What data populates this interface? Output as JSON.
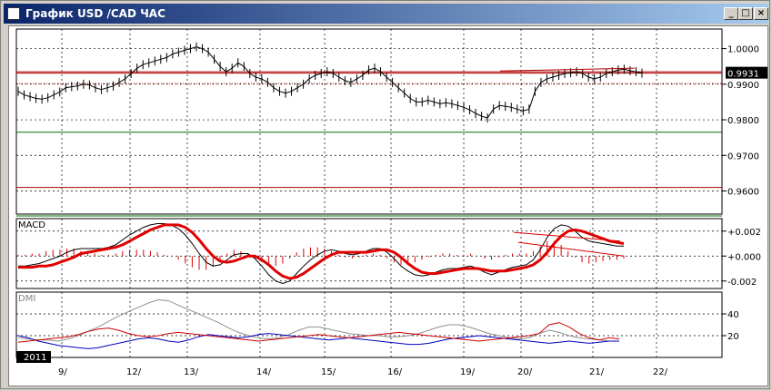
{
  "window": {
    "title": "График USD /CAD  ЧАС",
    "minimize_icon": "minimize-icon",
    "maximize_icon": "maximize-icon",
    "close_icon": "close-icon"
  },
  "colors": {
    "price": "#000000",
    "hline_red": "#b00000",
    "hline_green": "#007000",
    "macd_main": "#000000",
    "macd_signal": "#e00000",
    "macd_hist": "#e00000",
    "dmi_plus": "#0000c0",
    "dmi_minus": "#d00000",
    "adx": "#909090",
    "price_box_bg": "#000000"
  },
  "chart_data": [
    {
      "type": "line",
      "panel": "price",
      "current_price_label": "0.9931",
      "y_tick_labels": [
        "1.0000",
        "0.9900",
        "0.9800",
        "0.9700",
        "0.9600"
      ],
      "y_ticks": [
        1.0,
        0.99,
        0.98,
        0.97,
        0.96
      ],
      "ylim": [
        0.9535,
        1.0055
      ],
      "x_tick_labels": [
        "9/",
        "12/",
        "13/",
        "14/",
        "15/",
        "16/",
        "19/",
        "20/",
        "21/",
        "22/"
      ],
      "year_label": "2011",
      "horizontal_lines": [
        {
          "value": 0.9935,
          "color": "red"
        },
        {
          "value": 0.9931,
          "color": "red"
        },
        {
          "value": 0.9902,
          "color": "red",
          "dashed": true
        },
        {
          "value": 0.9765,
          "color": "green"
        },
        {
          "value": 0.961,
          "color": "red"
        },
        {
          "value": 0.953,
          "color": "green"
        }
      ],
      "close": [
        0.988,
        0.987,
        0.9865,
        0.986,
        0.9858,
        0.9862,
        0.987,
        0.9878,
        0.989,
        0.9893,
        0.9895,
        0.99,
        0.9898,
        0.989,
        0.9885,
        0.989,
        0.9895,
        0.9905,
        0.9915,
        0.993,
        0.9945,
        0.9955,
        0.996,
        0.9965,
        0.997,
        0.9975,
        0.9985,
        0.999,
        0.9995,
        1.0,
        1.0005,
        1.0,
        0.999,
        0.997,
        0.995,
        0.9935,
        0.9945,
        0.996,
        0.995,
        0.993,
        0.992,
        0.9915,
        0.9905,
        0.989,
        0.988,
        0.9875,
        0.988,
        0.989,
        0.99,
        0.9915,
        0.9925,
        0.993,
        0.9935,
        0.993,
        0.992,
        0.991,
        0.9905,
        0.9915,
        0.9925,
        0.994,
        0.9945,
        0.9935,
        0.992,
        0.9905,
        0.989,
        0.9875,
        0.986,
        0.985,
        0.985,
        0.9855,
        0.985,
        0.9845,
        0.9848,
        0.9845,
        0.984,
        0.9835,
        0.9828,
        0.9818,
        0.981,
        0.9805,
        0.983,
        0.984,
        0.9838,
        0.9835,
        0.983,
        0.9825,
        0.983,
        0.988,
        0.9905,
        0.9915,
        0.992,
        0.9925,
        0.993,
        0.9932,
        0.9935,
        0.993,
        0.992,
        0.9915,
        0.992,
        0.993,
        0.9935,
        0.994,
        0.9942,
        0.9938,
        0.9935,
        0.9931
      ]
    },
    {
      "type": "line",
      "panel": "macd",
      "title": "MACD",
      "y_tick_labels": [
        "+0.002",
        "+0.000",
        "-0.002"
      ],
      "y_ticks": [
        0.002,
        0.0,
        -0.002
      ],
      "ylim": [
        -0.0026,
        0.003
      ],
      "series": [
        {
          "name": "",
          "role": "main",
          "values": [
            -0.0008,
            -0.0008,
            -0.0007,
            -0.0006,
            -0.0004,
            -0.0002,
            0.0,
            0.0003,
            0.0005,
            0.0006,
            0.0006,
            0.0006,
            0.0006,
            0.0007,
            0.0009,
            0.0013,
            0.0017,
            0.002,
            0.0023,
            0.0025,
            0.0026,
            0.0026,
            0.0025,
            0.0022,
            0.0017,
            0.001,
            0.0002,
            -0.0005,
            -0.0008,
            -0.0007,
            -0.0003,
            0.0001,
            0.0002,
            0.0002,
            -0.0002,
            -0.0008,
            -0.0015,
            -0.002,
            -0.0022,
            -0.002,
            -0.0014,
            -0.0008,
            -0.0003,
            0.0001,
            0.0004,
            0.0005,
            0.0004,
            0.0002,
            0.0001,
            0.0002,
            0.0004,
            0.0006,
            0.0006,
            0.0003,
            -0.0002,
            -0.0008,
            -0.0012,
            -0.0015,
            -0.0016,
            -0.0015,
            -0.0013,
            -0.0011,
            -0.001,
            -0.001,
            -0.0009,
            -0.0008,
            -0.001,
            -0.0013,
            -0.0015,
            -0.0013,
            -0.0011,
            -0.0009,
            -0.0008,
            -0.0007,
            -0.0003,
            0.0005,
            0.0015,
            0.0022,
            0.0025,
            0.0024,
            0.002,
            0.0015,
            0.0012,
            0.0011,
            0.001,
            0.0009,
            0.0008,
            0.0008
          ]
        },
        {
          "name": "",
          "role": "signal",
          "values": [
            -0.0009,
            -0.0009,
            -0.0009,
            -0.0008,
            -0.0008,
            -0.0007,
            -0.0005,
            -0.0003,
            -0.0001,
            0.0002,
            0.0003,
            0.0004,
            0.0005,
            0.0006,
            0.0007,
            0.0009,
            0.0012,
            0.0015,
            0.0018,
            0.0021,
            0.0023,
            0.0025,
            0.0025,
            0.0025,
            0.0023,
            0.0019,
            0.0013,
            0.0006,
            0.0,
            -0.0004,
            -0.0005,
            -0.0004,
            -0.0002,
            0.0,
            0.0,
            -0.0003,
            -0.0007,
            -0.0012,
            -0.0016,
            -0.0018,
            -0.0017,
            -0.0014,
            -0.001,
            -0.0006,
            -0.0002,
            0.0001,
            0.0003,
            0.0003,
            0.0003,
            0.0003,
            0.0003,
            0.0004,
            0.0005,
            0.0005,
            0.0003,
            -0.0001,
            -0.0006,
            -0.001,
            -0.0013,
            -0.0014,
            -0.0014,
            -0.0013,
            -0.0012,
            -0.0011,
            -0.001,
            -0.001,
            -0.001,
            -0.0011,
            -0.0012,
            -0.0012,
            -0.0012,
            -0.0011,
            -0.001,
            -0.0009,
            -0.0007,
            -0.0003,
            0.0003,
            0.001,
            0.0016,
            0.002,
            0.0021,
            0.002,
            0.0018,
            0.0016,
            0.0014,
            0.0012,
            0.0011,
            0.001
          ]
        },
        {
          "name": "",
          "role": "histogram",
          "values": [
            0.0001,
            0.0001,
            0.0002,
            0.0002,
            0.0004,
            0.0005,
            0.0005,
            0.0006,
            0.0006,
            0.0004,
            0.0003,
            0.0002,
            0.0001,
            0.0001,
            0.0002,
            0.0004,
            0.0005,
            0.0005,
            0.0005,
            0.0004,
            0.0003,
            0.0001,
            0.0,
            -0.0003,
            -0.0006,
            -0.0009,
            -0.0011,
            -0.0011,
            -0.0008,
            -0.0003,
            0.0002,
            0.0005,
            0.0004,
            0.0002,
            -0.0002,
            -0.0005,
            -0.0008,
            -0.0008,
            -0.0006,
            -0.0002,
            0.0003,
            0.0006,
            0.0007,
            0.0007,
            0.0006,
            0.0004,
            0.0001,
            -0.0001,
            -0.0002,
            -0.0001,
            0.0001,
            0.0002,
            0.0001,
            -0.0002,
            -0.0005,
            -0.0007,
            -0.0006,
            -0.0005,
            -0.0003,
            -0.0001,
            0.0001,
            0.0002,
            0.0002,
            0.0001,
            0.0001,
            0.0002,
            0.0,
            -0.0002,
            -0.0003,
            -0.0001,
            0.0001,
            0.0002,
            0.0002,
            0.0002,
            0.0004,
            0.0008,
            0.0012,
            0.0012,
            0.0009,
            0.0004,
            -0.0001,
            -0.0005,
            -0.0006,
            -0.0005,
            -0.0004,
            -0.0003,
            -0.0003,
            -0.0002
          ]
        }
      ]
    },
    {
      "type": "line",
      "panel": "dmi",
      "title": "DMI",
      "y_tick_labels": [
        "40",
        "20"
      ],
      "y_ticks": [
        40,
        20
      ],
      "ylim": [
        0,
        60
      ],
      "series": [
        {
          "name": "",
          "role": "adx",
          "values": [
            18,
            17,
            16,
            16,
            15,
            17,
            20,
            24,
            28,
            33,
            38,
            42,
            46,
            50,
            53,
            52,
            48,
            44,
            40,
            36,
            32,
            27,
            23,
            20,
            18,
            17,
            18,
            21,
            25,
            28,
            28,
            26,
            24,
            22,
            21,
            20,
            20,
            19,
            19,
            20,
            22,
            25,
            28,
            30,
            30,
            28,
            25,
            22,
            20,
            18,
            17,
            18,
            22,
            25,
            23,
            20,
            18,
            17,
            16,
            15,
            15
          ]
        },
        {
          "name": "",
          "role": "plus_di",
          "values": [
            20,
            18,
            15,
            13,
            11,
            10,
            9,
            8,
            9,
            11,
            13,
            15,
            17,
            18,
            17,
            15,
            14,
            16,
            19,
            21,
            20,
            19,
            18,
            19,
            21,
            22,
            21,
            20,
            19,
            18,
            17,
            16,
            17,
            18,
            17,
            16,
            15,
            14,
            13,
            12,
            12,
            13,
            15,
            17,
            18,
            19,
            20,
            19,
            18,
            17,
            16,
            15,
            14,
            13,
            14,
            15,
            14,
            13,
            14,
            15,
            15
          ]
        },
        {
          "name": "",
          "role": "minus_di",
          "values": [
            14,
            15,
            16,
            17,
            18,
            19,
            21,
            24,
            26,
            27,
            25,
            22,
            20,
            19,
            20,
            22,
            23,
            22,
            21,
            20,
            19,
            18,
            17,
            16,
            15,
            16,
            17,
            18,
            19,
            20,
            21,
            20,
            19,
            18,
            19,
            20,
            21,
            22,
            23,
            22,
            21,
            20,
            19,
            18,
            17,
            16,
            15,
            16,
            17,
            18,
            19,
            20,
            22,
            30,
            32,
            28,
            22,
            18,
            16,
            18,
            17
          ]
        }
      ]
    }
  ]
}
